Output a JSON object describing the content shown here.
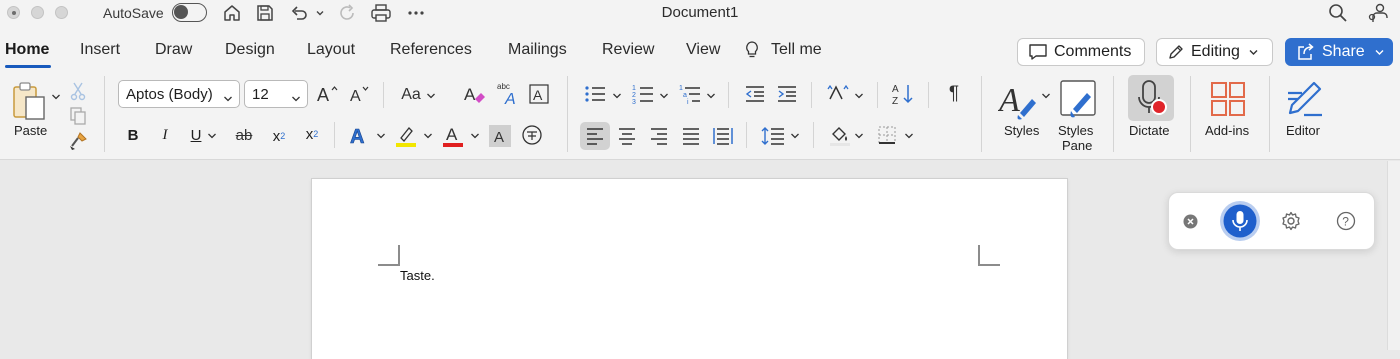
{
  "titlebar": {
    "autosave_label": "AutoSave",
    "autosave_on": false,
    "document_title": "Document1"
  },
  "tabs": [
    {
      "label": "Home",
      "active": true
    },
    {
      "label": "Insert"
    },
    {
      "label": "Draw"
    },
    {
      "label": "Design"
    },
    {
      "label": "Layout"
    },
    {
      "label": "References"
    },
    {
      "label": "Mailings"
    },
    {
      "label": "Review"
    },
    {
      "label": "View"
    },
    {
      "label": "Tell me"
    }
  ],
  "actions": {
    "comments_label": "Comments",
    "editing_label": "Editing",
    "share_label": "Share"
  },
  "ribbon": {
    "paste_label": "Paste",
    "font_name": "Aptos (Body)",
    "font_size": "12",
    "styles_label": "Styles",
    "styles_pane_label_1": "Styles",
    "styles_pane_label_2": "Pane",
    "dictate_label": "Dictate",
    "addins_label": "Add-ins",
    "editor_label": "Editor",
    "case_label": "Aa",
    "bold": "B",
    "italic": "I",
    "underline": "U",
    "strike": "ab",
    "subscript": "x",
    "superscript": "x",
    "font_color_letter": "A",
    "highlight_color": "#f2e600",
    "font_color": "#e01f1f",
    "accent_color": "#185abd"
  },
  "document": {
    "body_text": "Taste."
  },
  "dictation": {
    "mic_active": true,
    "mic_color": "#1f5fcc"
  }
}
